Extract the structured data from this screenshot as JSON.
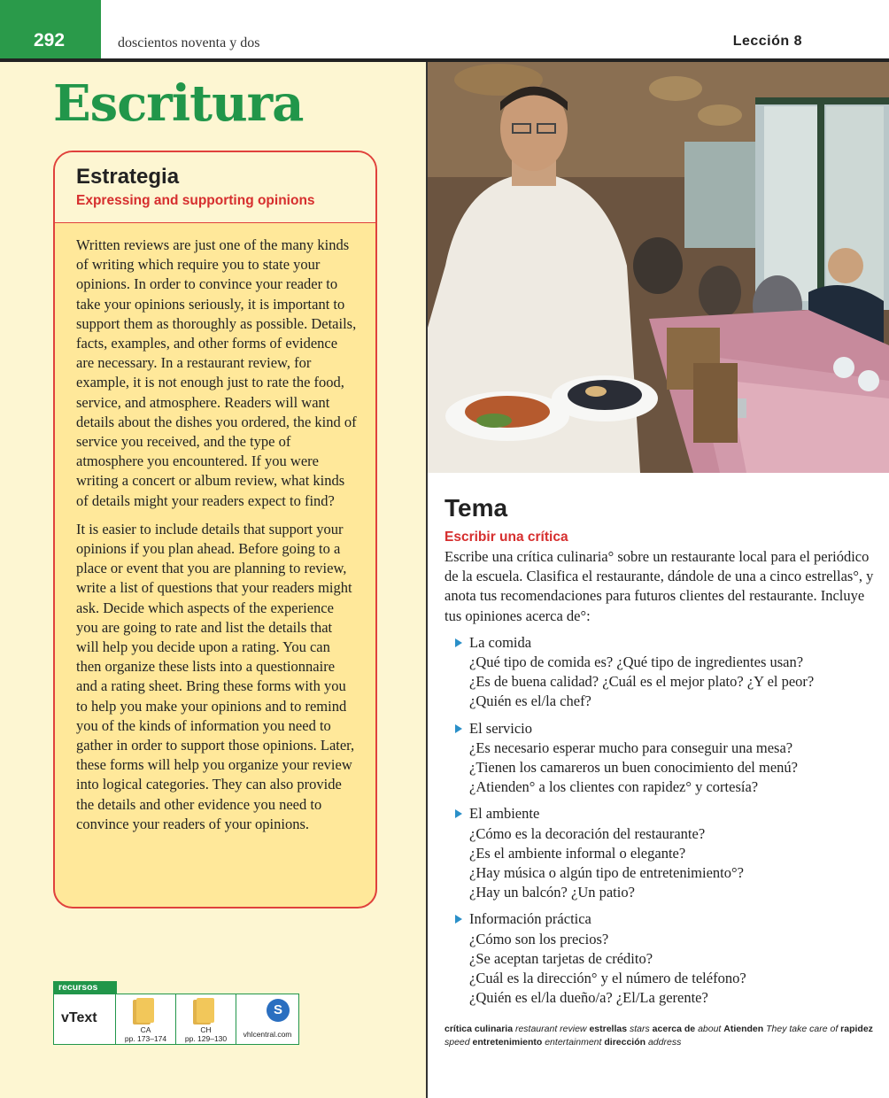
{
  "header": {
    "page_number": "292",
    "page_words": "doscientos noventa y dos",
    "lesson": "Lección 8"
  },
  "section_title": "Escritura",
  "strategy": {
    "title": "Estrategia",
    "subtitle": "Expressing and supporting opinions",
    "paragraphs": [
      "Written reviews are just one of the many kinds of writing which require you to state your opinions. In order to convince your reader to take your opinions seriously, it is important to support them as thoroughly as possible. Details, facts, examples, and other forms of evidence are necessary. In a restaurant review, for example, it is not enough just to rate the food, service, and atmosphere. Readers will want details about the dishes you ordered, the kind of service you received, and the type of atmosphere you encountered. If you were writing a concert or album review, what kinds of details might your readers expect to find?",
      "It is easier to include details that support your opinions if you plan ahead. Before going to a place or event that you are planning to review, write a list of questions that your readers might ask. Decide which aspects of the experience you are going to rate and list the details that will help you decide upon a rating. You can then organize these lists into a questionnaire and a rating sheet. Bring these forms with you to help you make your opinions and to remind you of the kinds of information you need to gather in order to support those opinions. Later, these forms will help you organize your review into logical categories. They can also provide the details and other evidence you need to convince your readers of your opinions."
    ]
  },
  "recursos": {
    "label": "recursos",
    "vtext": "vText",
    "ca_label": "CA",
    "ca_pages": "pp. 173–174",
    "ch_label": "CH",
    "ch_pages": "pp. 129–130",
    "vhl": "vhlcentral.com",
    "vhl_icon": "S"
  },
  "tema": {
    "title": "Tema",
    "subtitle": "Escribir una crítica",
    "intro": "Escribe una crítica culinaria° sobre un restaurante local para el periódico de la escuela. Clasifica el restaurante, dándole de una a cinco estrellas°, y anota tus recomendaciones para futuros clientes del restaurante. Incluye tus opiniones acerca de°:",
    "topics": [
      {
        "head": "La comida",
        "lines": [
          "¿Qué tipo de comida es? ¿Qué tipo de ingredientes usan?",
          "¿Es de buena calidad? ¿Cuál es el mejor plato? ¿Y el peor?",
          "¿Quién es el/la chef?"
        ]
      },
      {
        "head": "El servicio",
        "lines": [
          "¿Es necesario esperar mucho para conseguir una mesa?",
          "¿Tienen los camareros un buen conocimiento del menú?",
          "¿Atienden° a los clientes con rapidez° y cortesía?"
        ]
      },
      {
        "head": "El ambiente",
        "lines": [
          "¿Cómo es la decoración del restaurante?",
          "¿Es el ambiente informal o elegante?",
          "¿Hay música o algún tipo de entretenimiento°?",
          "¿Hay un balcón? ¿Un patio?"
        ]
      },
      {
        "head": "Información práctica",
        "lines": [
          "¿Cómo son los precios?",
          "¿Se aceptan tarjetas de crédito?",
          "¿Cuál es la dirección° y el número de teléfono?",
          "¿Quién es el/la dueño/a? ¿El/La gerente?"
        ]
      }
    ]
  },
  "glossary": [
    {
      "es": "crítica culinaria",
      "en": "restaurant review"
    },
    {
      "es": "estrellas",
      "en": "stars"
    },
    {
      "es": "acerca de",
      "en": "about"
    },
    {
      "es": "Atienden",
      "en": "They take care of"
    },
    {
      "es": "rapidez",
      "en": "speed"
    },
    {
      "es": "entretenimiento",
      "en": "entertainment"
    },
    {
      "es": "dirección",
      "en": "address"
    }
  ]
}
